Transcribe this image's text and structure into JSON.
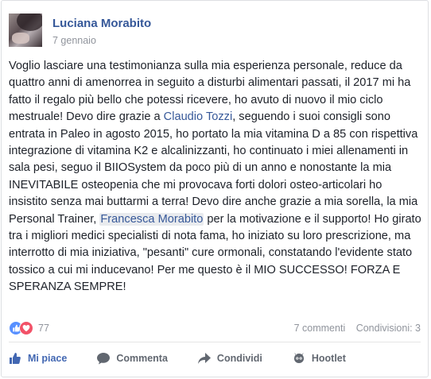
{
  "post": {
    "author": "Luciana Morabito",
    "date": "7 gennaio",
    "text_part1": "Voglio lasciare una testimonianza sulla mia esperienza personale, reduce da quattro anni di amenorrea in seguito a disturbi alimentari passati, il 2017 mi ha fatto il regalo più bello che potessi ricevere, ho avuto di nuovo il mio ciclo mestruale! Devo dire grazie a ",
    "mention1": "Claudio Tozzi",
    "text_part2": ", seguendo i suoi consigli sono entrata in Paleo in agosto 2015, ho portato la mia vitamina D a 85 con rispettiva integrazione di vitamina K2 e alcalinizzanti, ho continuato i miei allenamenti in sala pesi, seguo il BIIOSystem da poco più di un anno e nonostante la mia INEVITABILE osteopenia che mi provocava forti dolori osteo-articolari ho insistito senza mai buttarmi a terra! Devo dire anche grazie a mia sorella, la mia Personal Trainer, ",
    "mention2": "Francesca Morabito",
    "text_part3": " per la motivazione e il supporto! Ho girato tra i migliori medici specialisti di nota fama, ho iniziato su loro prescrizione, ma interrotto di mia iniziativa, \"pesanti\" cure ormonali, constatando l'evidente stato tossico a cui mi inducevano! Per me questo è il MIO SUCCESSO! FORZA E SPERANZA SEMPRE!"
  },
  "stats": {
    "reactions_count": "77",
    "comments": "7 commenti",
    "shares": "Condivisioni: 3"
  },
  "actions": {
    "like": "Mi piace",
    "comment": "Commenta",
    "share": "Condividi",
    "hootlet": "Hootlet"
  },
  "colors": {
    "link": "#365899",
    "like_active": "#4267b2",
    "like_reaction": "#5890ff",
    "love_reaction": "#f25268"
  },
  "icons": [
    "avatar-photo",
    "like-reaction-icon",
    "love-reaction-icon",
    "thumb-up-icon",
    "comment-bubble-icon",
    "share-arrow-icon",
    "hootlet-owl-icon"
  ]
}
